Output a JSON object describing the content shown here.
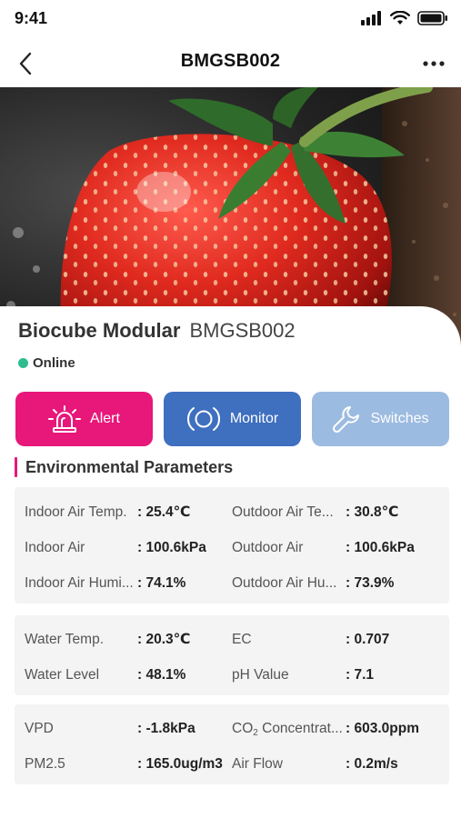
{
  "status_bar": {
    "time": "9:41",
    "icons": [
      "cellular-signal-icon",
      "wifi-icon",
      "battery-icon"
    ]
  },
  "nav": {
    "title": "BMGSB002",
    "back_icon": "chevron-left-icon",
    "more_icon": "more-horizontal-icon"
  },
  "hero": {
    "image": "strawberry-photo"
  },
  "device": {
    "model": "Biocube Modular",
    "code": "BMGSB002",
    "status": "Online",
    "status_color": "#2dbd8f"
  },
  "actions": [
    {
      "label": "Alert",
      "icon": "siren-icon",
      "color": "#e8177a"
    },
    {
      "label": "Monitor",
      "icon": "monitor-target-icon",
      "color": "#3f6fbf"
    },
    {
      "label": "Switches",
      "icon": "wrench-icon",
      "color": "#9cbbe0"
    }
  ],
  "section": {
    "title": "Environmental Parameters",
    "accent_color": "#e8177a"
  },
  "groups": [
    {
      "rows": [
        {
          "label1": "Indoor Air Temp.",
          "value1": ": 25.4℃",
          "label2": "Outdoor Air Te...",
          "value2": ": 30.8℃"
        },
        {
          "label1": "Indoor Air",
          "value1": ": 100.6kPa",
          "label2": "Outdoor Air",
          "value2": ": 100.6kPa"
        },
        {
          "label1": "Indoor Air Humi...",
          "value1": ": 74.1%",
          "label2": "Outdoor Air Hu...",
          "value2": ": 73.9%"
        }
      ]
    },
    {
      "rows": [
        {
          "label1": "Water Temp.",
          "value1": ": 20.3℃",
          "label2": "EC",
          "value2": ": 0.707"
        },
        {
          "label1": "Water Level",
          "value1": ": 48.1%",
          "label2": "pH Value",
          "value2": ": 7.1"
        }
      ]
    },
    {
      "rows": [
        {
          "label1": "VPD",
          "value1": ": -1.8kPa",
          "label2_prefix": "CO",
          "label2_sub": "2",
          "label2_suffix": " Concentrat...",
          "value2": ": 603.0ppm"
        },
        {
          "label1": "PM2.5",
          "value1": ": 165.0ug/m3",
          "label2": "Air Flow",
          "value2": ": 0.2m/s"
        }
      ]
    }
  ]
}
